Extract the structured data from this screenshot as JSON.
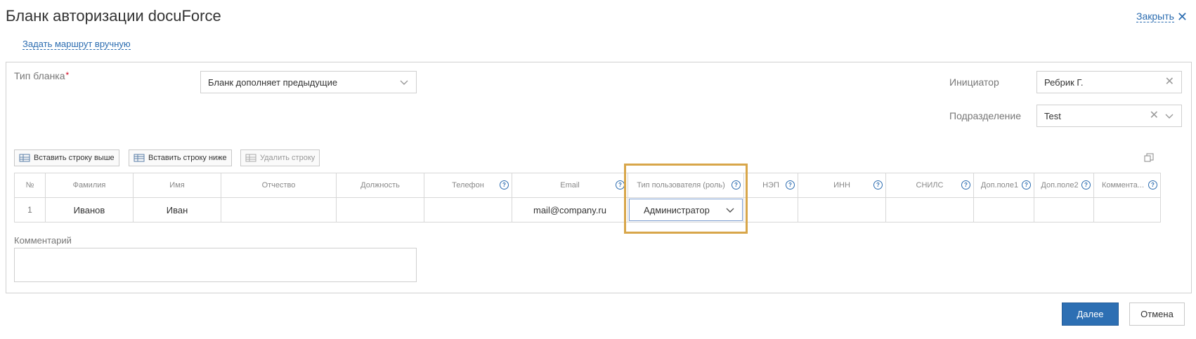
{
  "window": {
    "title": "Бланк авторизации docuForce",
    "close_label": "Закрыть",
    "manual_route_link": "Задать маршрут вручную"
  },
  "form": {
    "blank_type": {
      "label": "Тип бланка",
      "required_mark": "*",
      "value": "Бланк дополняет предыдущие"
    },
    "initiator": {
      "label": "Инициатор",
      "value": "Ребрик Г."
    },
    "department": {
      "label": "Подразделение",
      "value": "Test"
    }
  },
  "toolbar": {
    "insert_above": "Вставить строку выше",
    "insert_below": "Вставить строку ниже",
    "delete_row": "Удалить строку"
  },
  "table": {
    "columns": [
      {
        "key": "num",
        "label": "№",
        "help": false
      },
      {
        "key": "last_name",
        "label": "Фамилия",
        "help": false
      },
      {
        "key": "first_name",
        "label": "Имя",
        "help": false
      },
      {
        "key": "middle_name",
        "label": "Отчество",
        "help": false
      },
      {
        "key": "position",
        "label": "Должность",
        "help": false
      },
      {
        "key": "phone",
        "label": "Телефон",
        "help": true
      },
      {
        "key": "email",
        "label": "Email",
        "help": true
      },
      {
        "key": "role",
        "label": "Тип пользователя (роль)",
        "help": true
      },
      {
        "key": "nep",
        "label": "НЭП",
        "help": true
      },
      {
        "key": "inn",
        "label": "ИНН",
        "help": true
      },
      {
        "key": "snils",
        "label": "СНИЛС",
        "help": true
      },
      {
        "key": "extra1",
        "label": "Доп.поле1",
        "help": true
      },
      {
        "key": "extra2",
        "label": "Доп.поле2",
        "help": true
      },
      {
        "key": "comment",
        "label": "Коммента...",
        "help": true
      }
    ],
    "rows": [
      {
        "num": "1",
        "last_name": "Иванов",
        "first_name": "Иван",
        "middle_name": "",
        "position": "",
        "phone": "",
        "email": "mail@company.ru",
        "role": "Администратор",
        "nep": "",
        "inn": "",
        "snils": "",
        "extra1": "",
        "extra2": "",
        "comment": ""
      }
    ]
  },
  "comment": {
    "label": "Комментарий",
    "value": ""
  },
  "actions": {
    "next": "Далее",
    "cancel": "Отмена"
  },
  "colors": {
    "accent": "#2d6fb3",
    "highlight": "#d8a64a",
    "required": "#d0021b"
  }
}
